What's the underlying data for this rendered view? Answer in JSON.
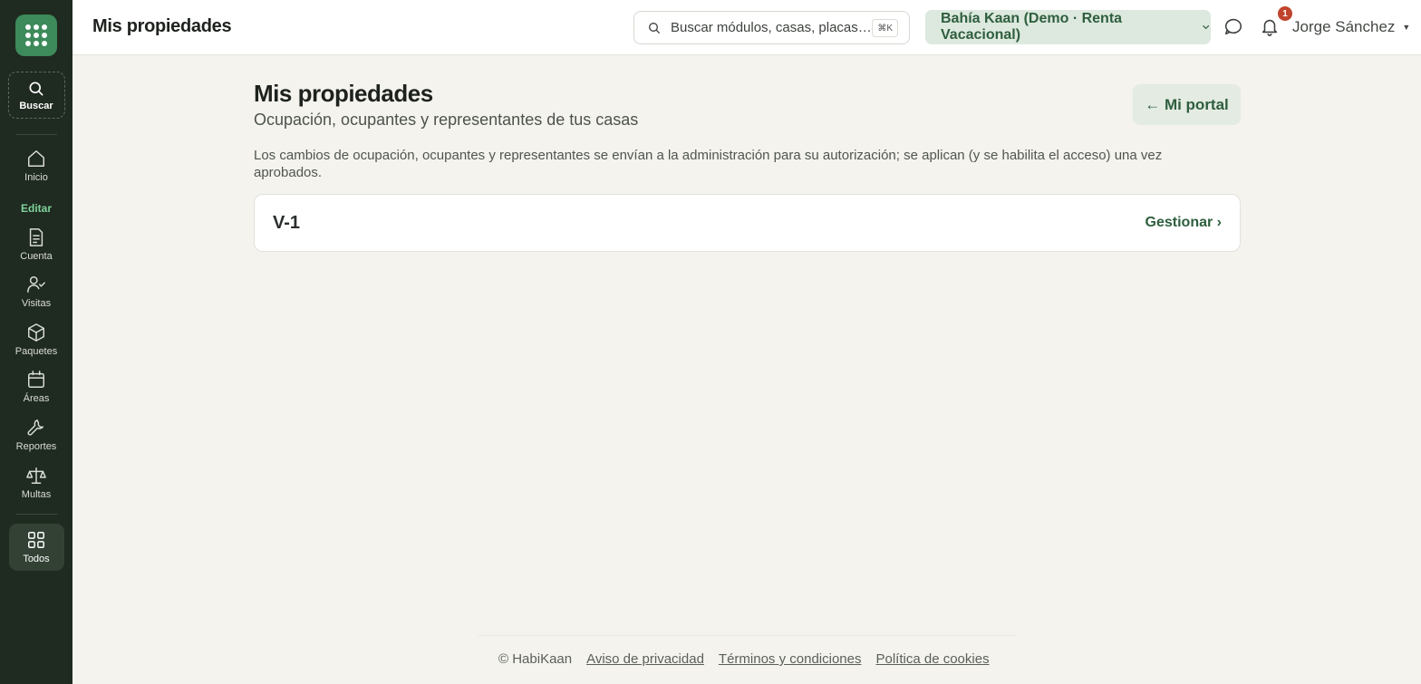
{
  "sidebar": {
    "search_label": "Buscar",
    "section_label": "Editar",
    "items": [
      {
        "label": "Inicio",
        "icon": "home-icon"
      },
      {
        "label": "Cuenta",
        "icon": "receipt-icon"
      },
      {
        "label": "Visitas",
        "icon": "user-check-icon"
      },
      {
        "label": "Paquetes",
        "icon": "box-icon"
      },
      {
        "label": "Áreas",
        "icon": "calendar-icon"
      },
      {
        "label": "Reportes",
        "icon": "wrench-icon"
      },
      {
        "label": "Multas",
        "icon": "scale-icon"
      }
    ],
    "all_label": "Todos"
  },
  "header": {
    "title": "Mis propiedades",
    "search_placeholder": "Buscar módulos, casas, placas…",
    "search_shortcut": "⌘K",
    "property_selector": "Bahía Kaan (Demo · Renta Vacacional)",
    "notification_count": "1",
    "user_name": "Jorge Sánchez"
  },
  "main": {
    "title": "Mis propiedades",
    "subtitle": "Ocupación, ocupantes y representantes de tus casas",
    "portal_button": "← Mi portal",
    "notice": "Los cambios de ocupación, ocupantes y representantes se envían a la administración para su autorización; se aplican (y se habilita el acceso) una vez aprobados.",
    "houses": [
      {
        "name": "V-1",
        "action": "Gestionar ›"
      }
    ]
  },
  "footer": {
    "copyright": "© HabiKaan",
    "links": [
      "Aviso de privacidad",
      "Términos y condiciones",
      "Política de cookies"
    ]
  },
  "colors": {
    "sidebar_bg": "#1f2a20",
    "accent": "#3d8a5a",
    "accent_text": "#2e5e3e",
    "page_bg": "#f4f3ee"
  }
}
